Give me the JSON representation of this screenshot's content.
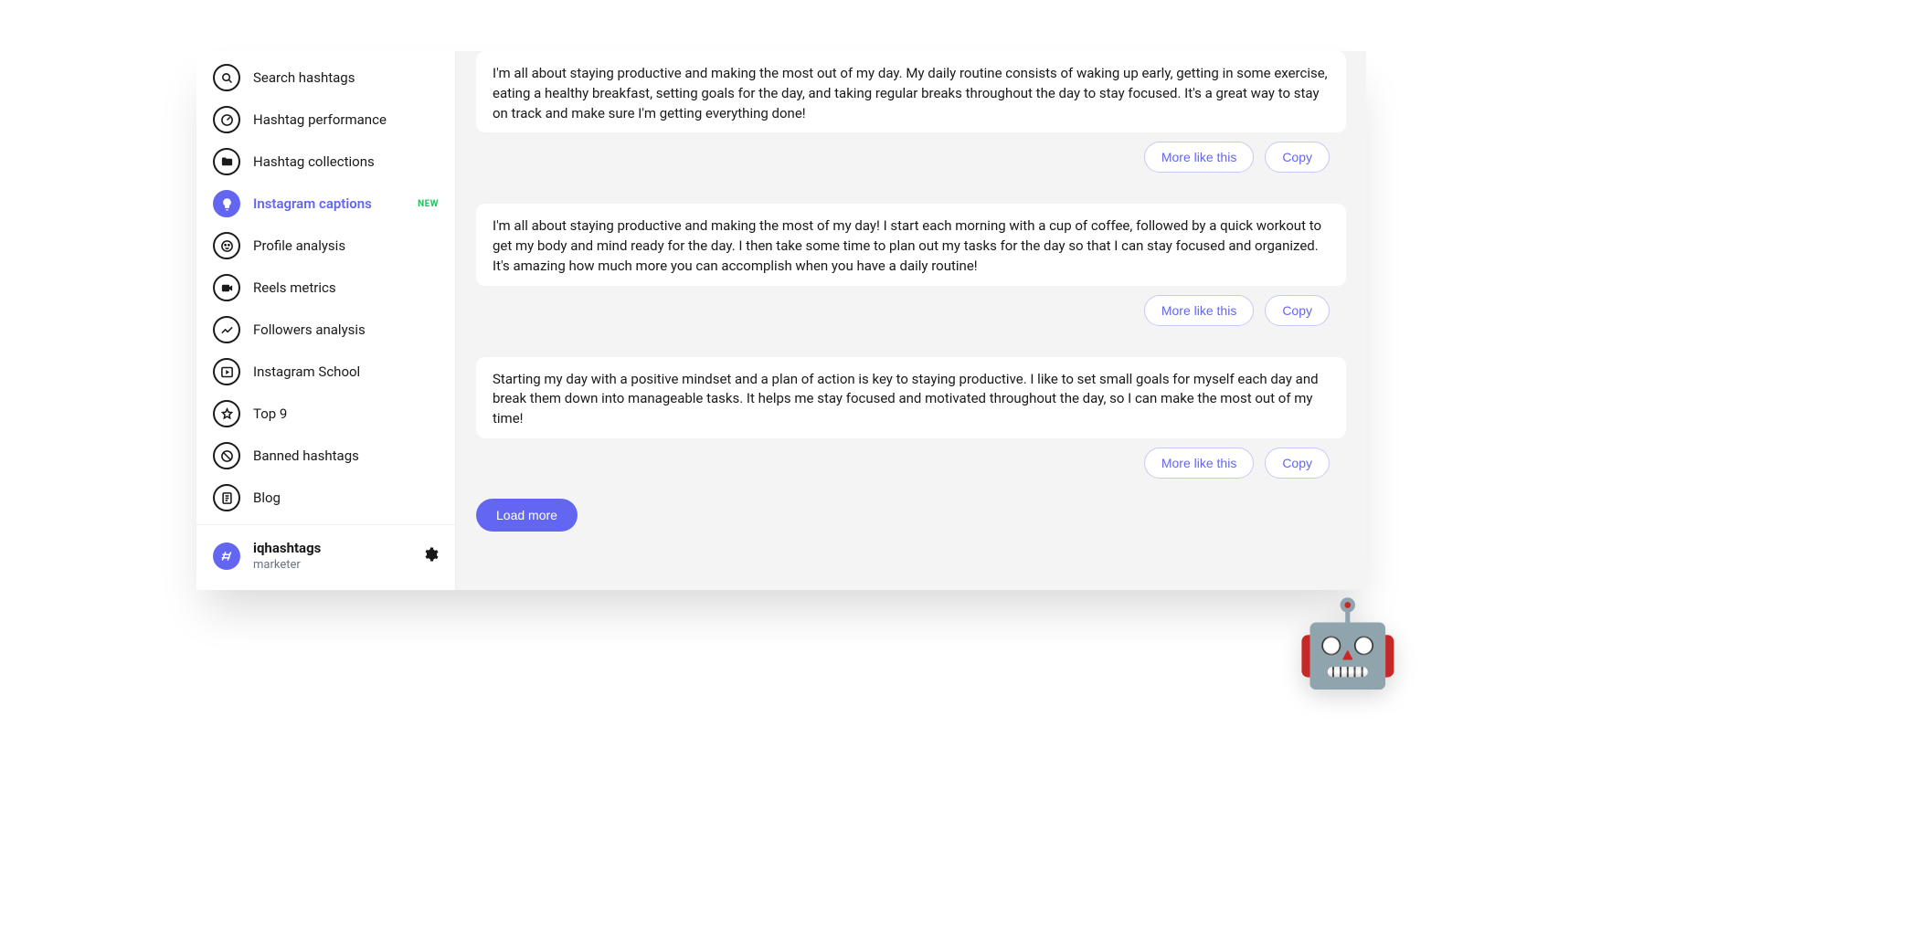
{
  "sidebar": {
    "items": [
      {
        "label": "Search hashtags",
        "icon": "search",
        "active": false
      },
      {
        "label": "Hashtag performance",
        "icon": "gauge",
        "active": false
      },
      {
        "label": "Hashtag collections",
        "icon": "folder",
        "active": false
      },
      {
        "label": "Instagram captions",
        "icon": "bulb",
        "active": true,
        "badge": "NEW"
      },
      {
        "label": "Profile analysis",
        "icon": "face",
        "active": false
      },
      {
        "label": "Reels metrics",
        "icon": "video",
        "active": false
      },
      {
        "label": "Followers analysis",
        "icon": "trend",
        "active": false
      },
      {
        "label": "Instagram School",
        "icon": "play",
        "active": false
      },
      {
        "label": "Top 9",
        "icon": "star",
        "active": false
      },
      {
        "label": "Banned hashtags",
        "icon": "ban",
        "active": false
      },
      {
        "label": "Blog",
        "icon": "article",
        "active": false
      }
    ]
  },
  "user": {
    "name": "iqhashtags",
    "role": "marketer"
  },
  "captions": [
    {
      "text": "I'm all about staying productive and making the most out of my day. My daily routine consists of waking up early, getting in some exercise, eating a healthy breakfast, setting goals for the day, and taking regular breaks throughout the day to stay focused. It's a great way to stay on track and make sure I'm getting everything done!"
    },
    {
      "text": "I'm all about staying productive and making the most of my day! I start each morning with a cup of coffee, followed by a quick workout to get my body and mind ready for the day. I then take some time to plan out my tasks for the day so that I can stay focused and organized. It's amazing how much more you can accomplish when you have a daily routine!"
    },
    {
      "text": "Starting my day with a positive mindset and a plan of action is key to staying productive. I like to set small goals for myself each day and break them down into manageable tasks. It helps me stay focused and motivated throughout the day, so I can make the most out of my time!"
    }
  ],
  "buttons": {
    "more_like_this": "More like this",
    "copy": "Copy",
    "load_more": "Load more"
  },
  "float_emoji": "🤖"
}
